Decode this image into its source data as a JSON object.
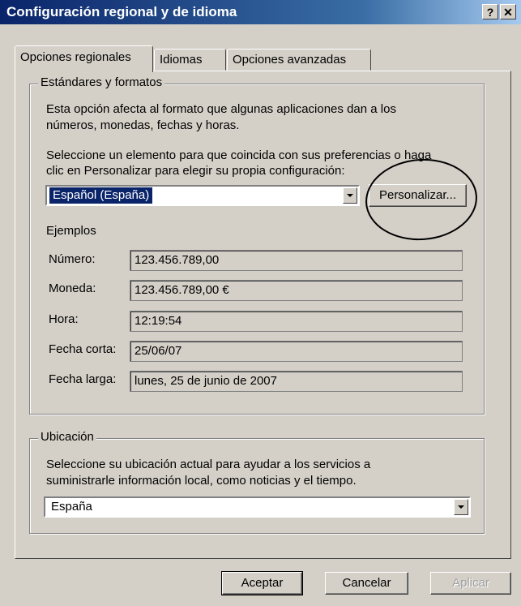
{
  "window": {
    "title": "Configuración regional y de idioma",
    "help_label": "?",
    "close_label": "✕"
  },
  "tabs": [
    {
      "label": "Opciones regionales"
    },
    {
      "label": "Idiomas"
    },
    {
      "label": "Opciones avanzadas"
    }
  ],
  "standards": {
    "group_label": "Estándares y formatos",
    "desc_line1": "Esta opción afecta al formato que algunas aplicaciones dan a los",
    "desc_line2": "números, monedas, fechas y horas.",
    "select_line1": "Seleccione un elemento para que coincida con sus preferencias o haga",
    "select_line2": "clic en Personalizar para elegir su propia configuración:",
    "locale_value": "Español (España)",
    "customize_label": "Personalizar...",
    "examples_label": "Ejemplos",
    "examples": [
      {
        "label": "Número:",
        "value": "123.456.789,00"
      },
      {
        "label": "Moneda:",
        "value": "123.456.789,00 €"
      },
      {
        "label": "Hora:",
        "value": "12:19:54"
      },
      {
        "label": "Fecha corta:",
        "value": "25/06/07"
      },
      {
        "label": "Fecha larga:",
        "value": "lunes, 25 de junio de 2007"
      }
    ]
  },
  "location": {
    "group_label": "Ubicación",
    "desc_line1": "Seleccione su ubicación actual para ayudar a los servicios a",
    "desc_line2": "suministrarle información local, como noticias y el tiempo.",
    "value": "España"
  },
  "buttons": {
    "accept": "Aceptar",
    "cancel": "Cancelar",
    "apply": "Aplicar"
  }
}
